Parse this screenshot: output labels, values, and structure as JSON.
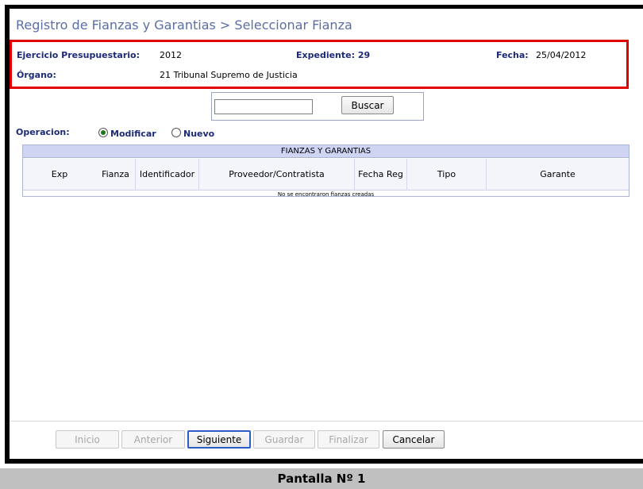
{
  "title": "Registro de Fianzas y Garantias > Seleccionar Fianza",
  "header": {
    "ejercicio_label": "Ejercicio Presupuestario:",
    "ejercicio_value": "2012",
    "expediente_label": "Expediente: 29",
    "fecha_label": "Fecha:",
    "fecha_value": "25/04/2012",
    "organo_label": "Órgano:",
    "organo_value": "21 Tribunal Supremo de Justicia"
  },
  "search": {
    "value": "",
    "button": "Buscar"
  },
  "operacion": {
    "label": "Operacion:",
    "options": [
      {
        "label": "Modificar",
        "selected": true
      },
      {
        "label": "Nuevo",
        "selected": false
      }
    ]
  },
  "grid": {
    "title": "FIANZAS Y GARANTIAS",
    "columns": [
      "Exp",
      "Fianza",
      "Identificador",
      "Proveedor/Contratista",
      "Fecha Reg",
      "Tipo",
      "Garante"
    ],
    "empty_message": "No se encontraron fianzas creadas"
  },
  "nav": {
    "inicio": "Inicio",
    "anterior": "Anterior",
    "siguiente": "Siguiente",
    "guardar": "Guardar",
    "finalizar": "Finalizar",
    "cancelar": "Cancelar"
  },
  "caption": "Pantalla Nº 1",
  "colors": {
    "highlight_border": "#e00000",
    "title": "#5a6ea8",
    "label": "#1c2a78",
    "grid_header": "#cfd4f3"
  }
}
